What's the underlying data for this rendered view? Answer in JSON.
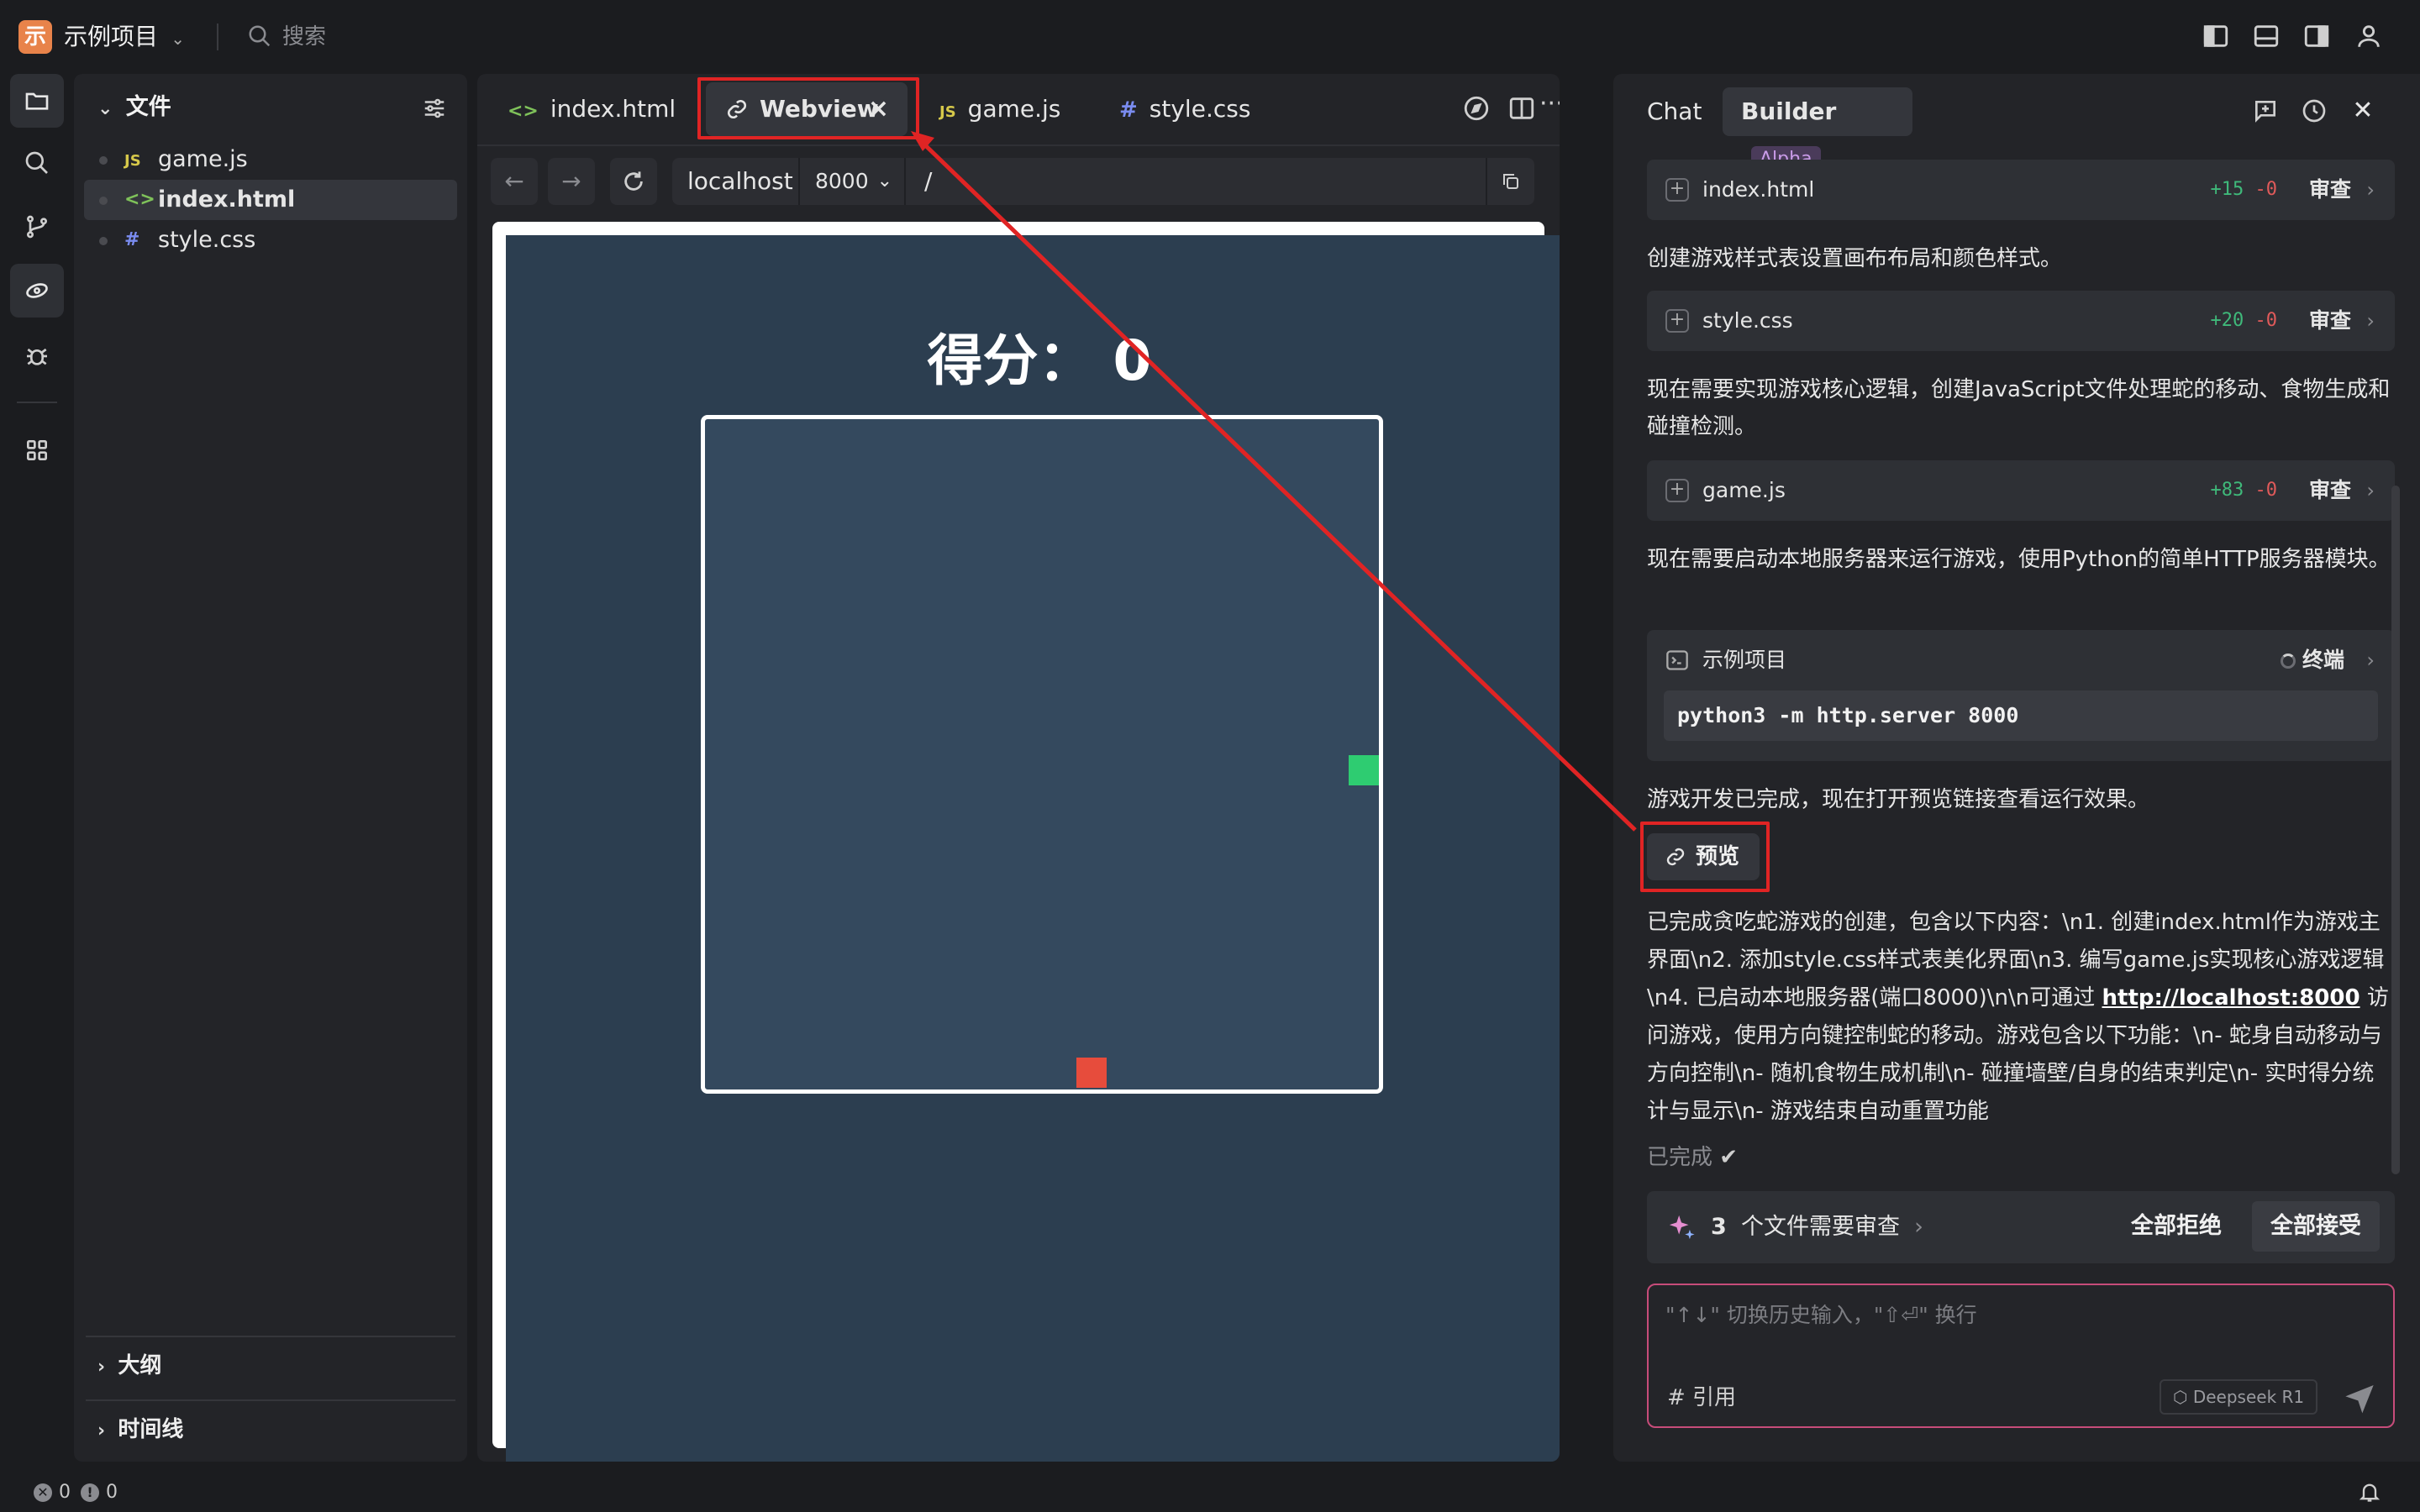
{
  "app": {
    "project_name": "示例项目",
    "project_initial": "示",
    "search_placeholder": "搜索"
  },
  "explorer": {
    "title": "文件",
    "files": [
      {
        "icon": "JS",
        "name": "game.js",
        "icon_color": "#d6c84a"
      },
      {
        "icon": "<>",
        "name": "index.html",
        "icon_color": "#7fc25a"
      },
      {
        "icon": "#",
        "name": "style.css",
        "icon_color": "#7a8cf0"
      }
    ],
    "sections": [
      "大纲",
      "时间线"
    ]
  },
  "editor": {
    "tabs": [
      {
        "icon": "<>",
        "label": "index.html",
        "icon_color": "#7fc25a"
      },
      {
        "icon": "link",
        "label": "Webview",
        "close": "×"
      },
      {
        "icon": "JS",
        "label": "game.js",
        "icon_color": "#d6c84a"
      },
      {
        "icon": "#",
        "label": "style.css",
        "icon_color": "#7a8cf0"
      }
    ],
    "browser": {
      "back": "←",
      "forward": "→",
      "host": "localhost",
      "port": "8000",
      "path": "/"
    },
    "game": {
      "score_label": "得分： 0",
      "background": "#2c3e50",
      "board_color": "#34495e",
      "snake_color": "#2ecc71",
      "food_color": "#e74c3c"
    }
  },
  "chat": {
    "tabs": {
      "chat": "Chat",
      "builder": "Builder",
      "builder_badge": "Alpha"
    },
    "file_cards": [
      {
        "name": "index.html",
        "added": "+15",
        "removed": "-0",
        "action": "审查"
      },
      {
        "name": "style.css",
        "added": "+20",
        "removed": "-0",
        "action": "审查"
      },
      {
        "name": "game.js",
        "added": "+83",
        "removed": "-0",
        "action": "审查"
      }
    ],
    "messages": {
      "m1": "创建游戏样式表设置画布布局和颜色样式。",
      "m2": "现在需要实现游戏核心逻辑，创建JavaScript文件处理蛇的移动、食物生成和碰撞检测。",
      "m3": "现在需要启动本地服务器来运行游戏，使用Python的简单HTTP服务器模块。",
      "m4": "游戏开发已完成，现在打开预览链接查看运行效果。",
      "summary_before_link": "已完成贪吃蛇游戏的创建，包含以下内容：\\n1. 创建index.html作为游戏主界面\\n2. 添加style.css样式表美化界面\\n3. 编写game.js实现核心游戏逻辑\\n4. 已启动本地服务器(端口8000)\\n\\n可通过 ",
      "summary_link": "http://localhost:8000",
      "summary_after_link": " 访问游戏，使用方向键控制蛇的移动。游戏包含以下功能：\\n- 蛇身自动移动与方向控制\\n- 随机食物生成机制\\n- 碰撞墙壁/自身的结束判定\\n- 实时得分统计与显示\\n- 游戏结束自动重置功能"
    },
    "terminal": {
      "title": "示例项目",
      "status": "终端",
      "command": "python3 -m http.server 8000"
    },
    "preview_button": "预览",
    "done_label": "已完成",
    "done_check": "✔",
    "review_bar": {
      "count": "3",
      "text": "个文件需要审查",
      "reject_all": "全部拒绝",
      "accept_all": "全部接受"
    },
    "input": {
      "placeholder": "\"↑↓\" 切换历史输入，\"⇧⏎\" 换行",
      "reference": "# 引用",
      "model": "Deepseek R1"
    }
  },
  "statusbar": {
    "errors": "0",
    "warnings": "0"
  },
  "annotation_color": "#e02424"
}
